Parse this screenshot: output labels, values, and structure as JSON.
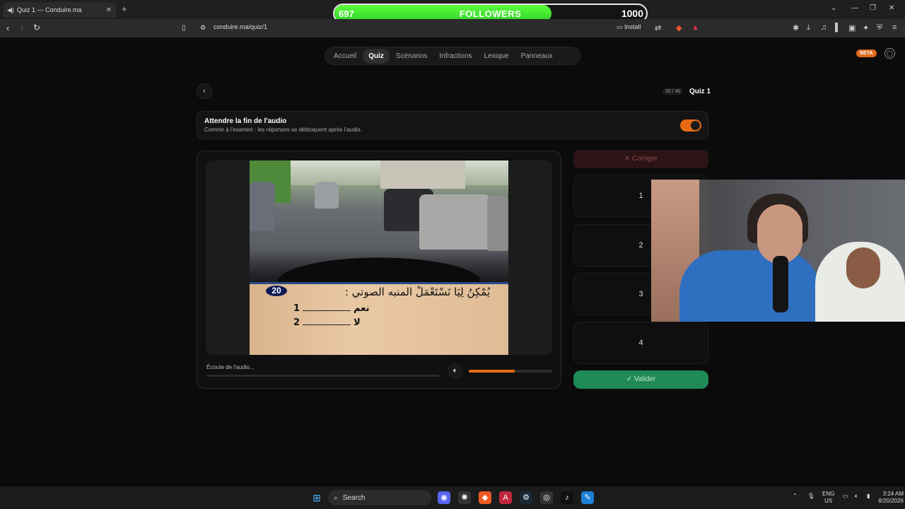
{
  "browser": {
    "tab_title": "Quiz 1 — Conduire.ma",
    "tab_close": "✕",
    "new_tab": "+",
    "url": "conduire.ma/quiz/1",
    "install_label": "Install"
  },
  "followers_overlay": {
    "current": "697",
    "label": "FOLLOWERS",
    "goal": "1000",
    "progress_fraction": 0.697
  },
  "site_nav": {
    "items": [
      "Accueil",
      "Quiz",
      "Scénarios",
      "Infractions",
      "Lexique",
      "Panneaux"
    ],
    "active": "Quiz",
    "beta_badge": "BETA"
  },
  "quiz_header": {
    "counter": "20 / 40",
    "quiz_name": "Quiz 1"
  },
  "audio_option": {
    "title": "Attendre la fin de l'audio",
    "subtitle": "Comme à l'examen : les réponses se débloquent après l'audio.",
    "enabled": true
  },
  "question": {
    "number": "20",
    "text_arabic": "يُمْكِنُ لِيَا نَسْتَعْمَلْ المنبه الصوتي :",
    "answers": [
      {
        "arabic": "نعم",
        "num": "1"
      },
      {
        "arabic": "لا",
        "num": "2"
      }
    ]
  },
  "player": {
    "status": "Écoute de l'audio...",
    "volume_fraction": 0.55
  },
  "answer_panel": {
    "correct_label": "✕  Corriger",
    "options": [
      "1",
      "2",
      "3",
      "4"
    ],
    "validate_label": "✓  Valider"
  },
  "taskbar": {
    "search_label": "Search",
    "lang_top": "ENG",
    "lang_bottom": "US",
    "time": "3:24 AM",
    "date": "8/20/2026"
  },
  "colors": {
    "accent_orange": "#e86b14",
    "validate_green": "#1e8a57",
    "followers_green": "#3ee82f"
  }
}
